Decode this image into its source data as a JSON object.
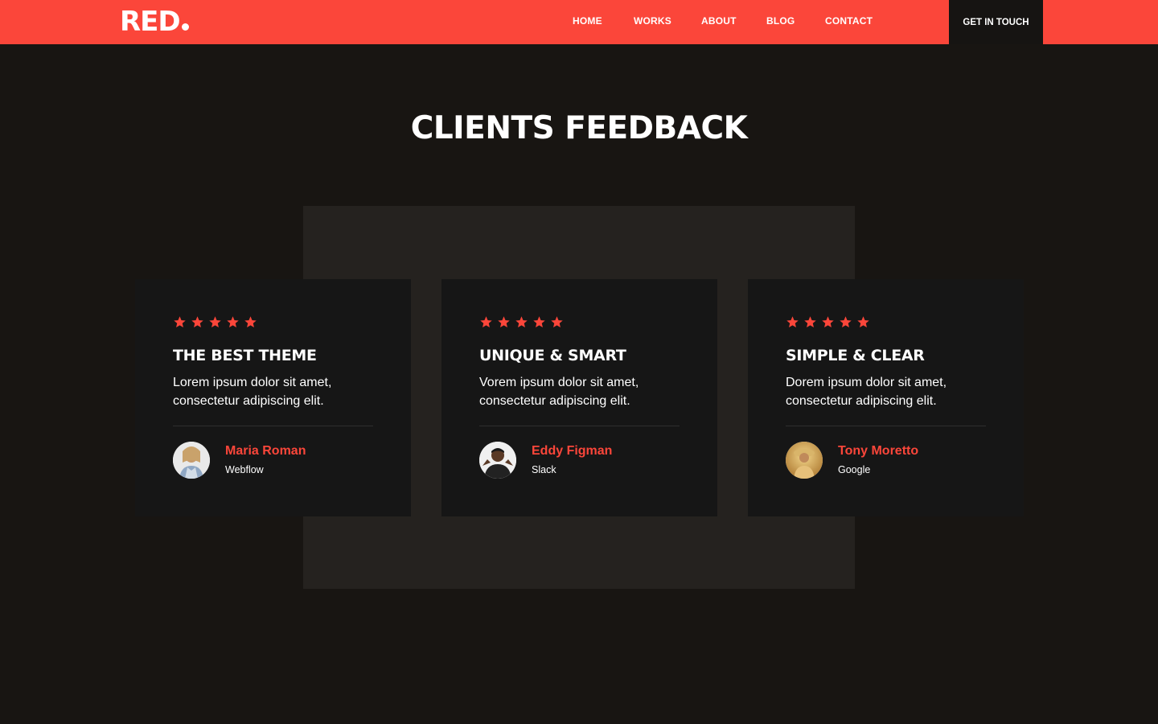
{
  "nav": {
    "logo": "RED",
    "links": [
      "HOME",
      "WORKS",
      "ABOUT",
      "BLOG",
      "CONTACT"
    ],
    "cta": "GET IN TOUCH"
  },
  "section": {
    "title": "CLIENTS FEEDBACK"
  },
  "testimonials": [
    {
      "rating": 5,
      "title": "THE BEST THEME",
      "text": "Lorem ipsum dolor sit amet, consectetur adipiscing elit.",
      "name": "Maria Roman",
      "company": "Webflow"
    },
    {
      "rating": 5,
      "title": "UNIQUE & SMART",
      "text": "Vorem ipsum dolor sit amet, consectetur adipiscing elit.",
      "name": "Eddy Figman",
      "company": "Slack"
    },
    {
      "rating": 5,
      "title": "SIMPLE & CLEAR",
      "text": "Dorem ipsum dolor sit amet, consectetur adipiscing elit.",
      "name": "Tony Moretto",
      "company": "Google"
    }
  ],
  "colors": {
    "accent": "#fb463a",
    "background": "#181512",
    "card": "#161616",
    "block": "#25221f"
  },
  "icons": {
    "rating": "star-icon"
  }
}
